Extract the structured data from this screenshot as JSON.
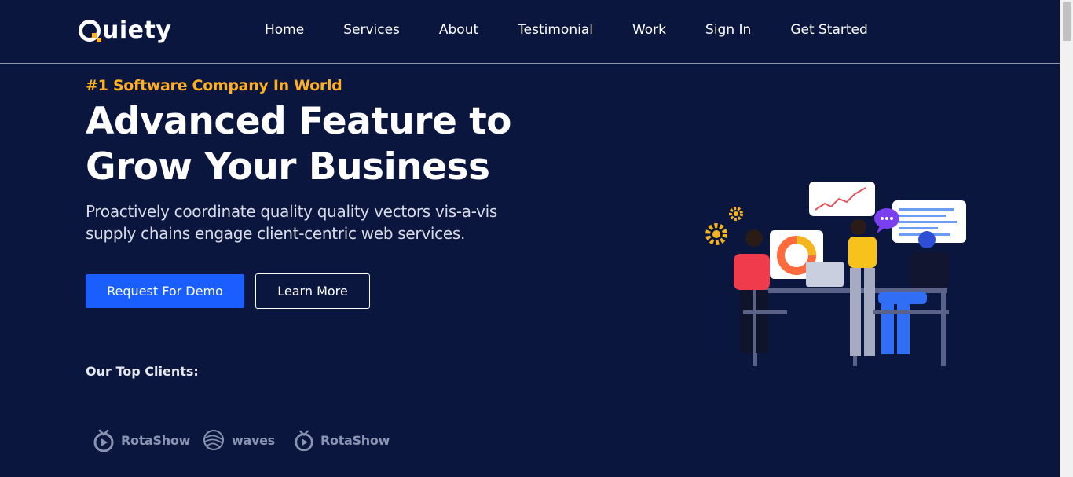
{
  "header": {
    "logo_text": "uiety",
    "logo_full": "Quiety",
    "nav": [
      "Home",
      "Services",
      "About",
      "Testimonial",
      "Work",
      "Sign In",
      "Get Started"
    ]
  },
  "hero": {
    "eyebrow": "#1 Software Company In World",
    "title_line1": "Advanced Feature to",
    "title_line2": "Grow Your Business",
    "desc_line1": "Proactively coordinate quality quality vectors vis-a-vis",
    "desc_line2": "supply chains engage client-centric web services.",
    "primary_button": "Request For Demo",
    "secondary_button": "Learn More"
  },
  "clients": {
    "label": "Our Top Clients:",
    "logos": [
      {
        "name": "RotaShow",
        "icon": "tv-icon"
      },
      {
        "name": "waves",
        "icon": "globe-icon"
      },
      {
        "name": "RotaShow",
        "icon": "tv-icon"
      }
    ]
  },
  "colors": {
    "background": "#0b163f",
    "accent_orange": "#ffaf1f",
    "primary_blue": "#1b5eff"
  }
}
